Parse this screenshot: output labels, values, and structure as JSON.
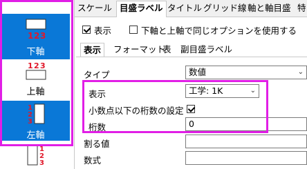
{
  "axis_panel": {
    "items": [
      {
        "label": "下軸",
        "selected": true,
        "tick_labels": [
          "1",
          "2",
          "3"
        ]
      },
      {
        "label": "上軸",
        "selected": false,
        "tick_labels": [
          "1",
          "2",
          "3"
        ]
      },
      {
        "label": "左軸",
        "selected": true,
        "tick_labels": [
          "1",
          "2",
          "3"
        ]
      },
      {
        "label": "",
        "selected": false,
        "tick_labels": [
          "1",
          "2",
          "3"
        ]
      }
    ]
  },
  "top_tabs": [
    "スケール",
    "目盛ラベル",
    "タイトル",
    "グリッド線",
    "軸と軸目盛",
    "特"
  ],
  "top_tab_active": "目盛ラベル",
  "show_checkbox": {
    "label": "表示",
    "checked": true
  },
  "same_option_checkbox": {
    "label": "下軸と上軸で同じオプションを使用する",
    "checked": false
  },
  "inner_tabs": [
    "表示",
    "フォーマット",
    "表",
    "副目盛ラベル"
  ],
  "inner_tab_active": "表示",
  "form": {
    "type_label": "タイプ",
    "type_value": "数値",
    "display_label": "表示",
    "display_value": "工学: 1K",
    "decimals_label": "小数点以下の桁数の設定",
    "decimals_checked": true,
    "digits_label": "桁数",
    "digits_value": "0",
    "divide_label": "割る値",
    "divide_value": "",
    "formula_label": "数式",
    "formula_value": ""
  },
  "colors": {
    "selected": "#0a78d7",
    "highlight": "#e11ee6",
    "tick_red": "#e0182a"
  }
}
